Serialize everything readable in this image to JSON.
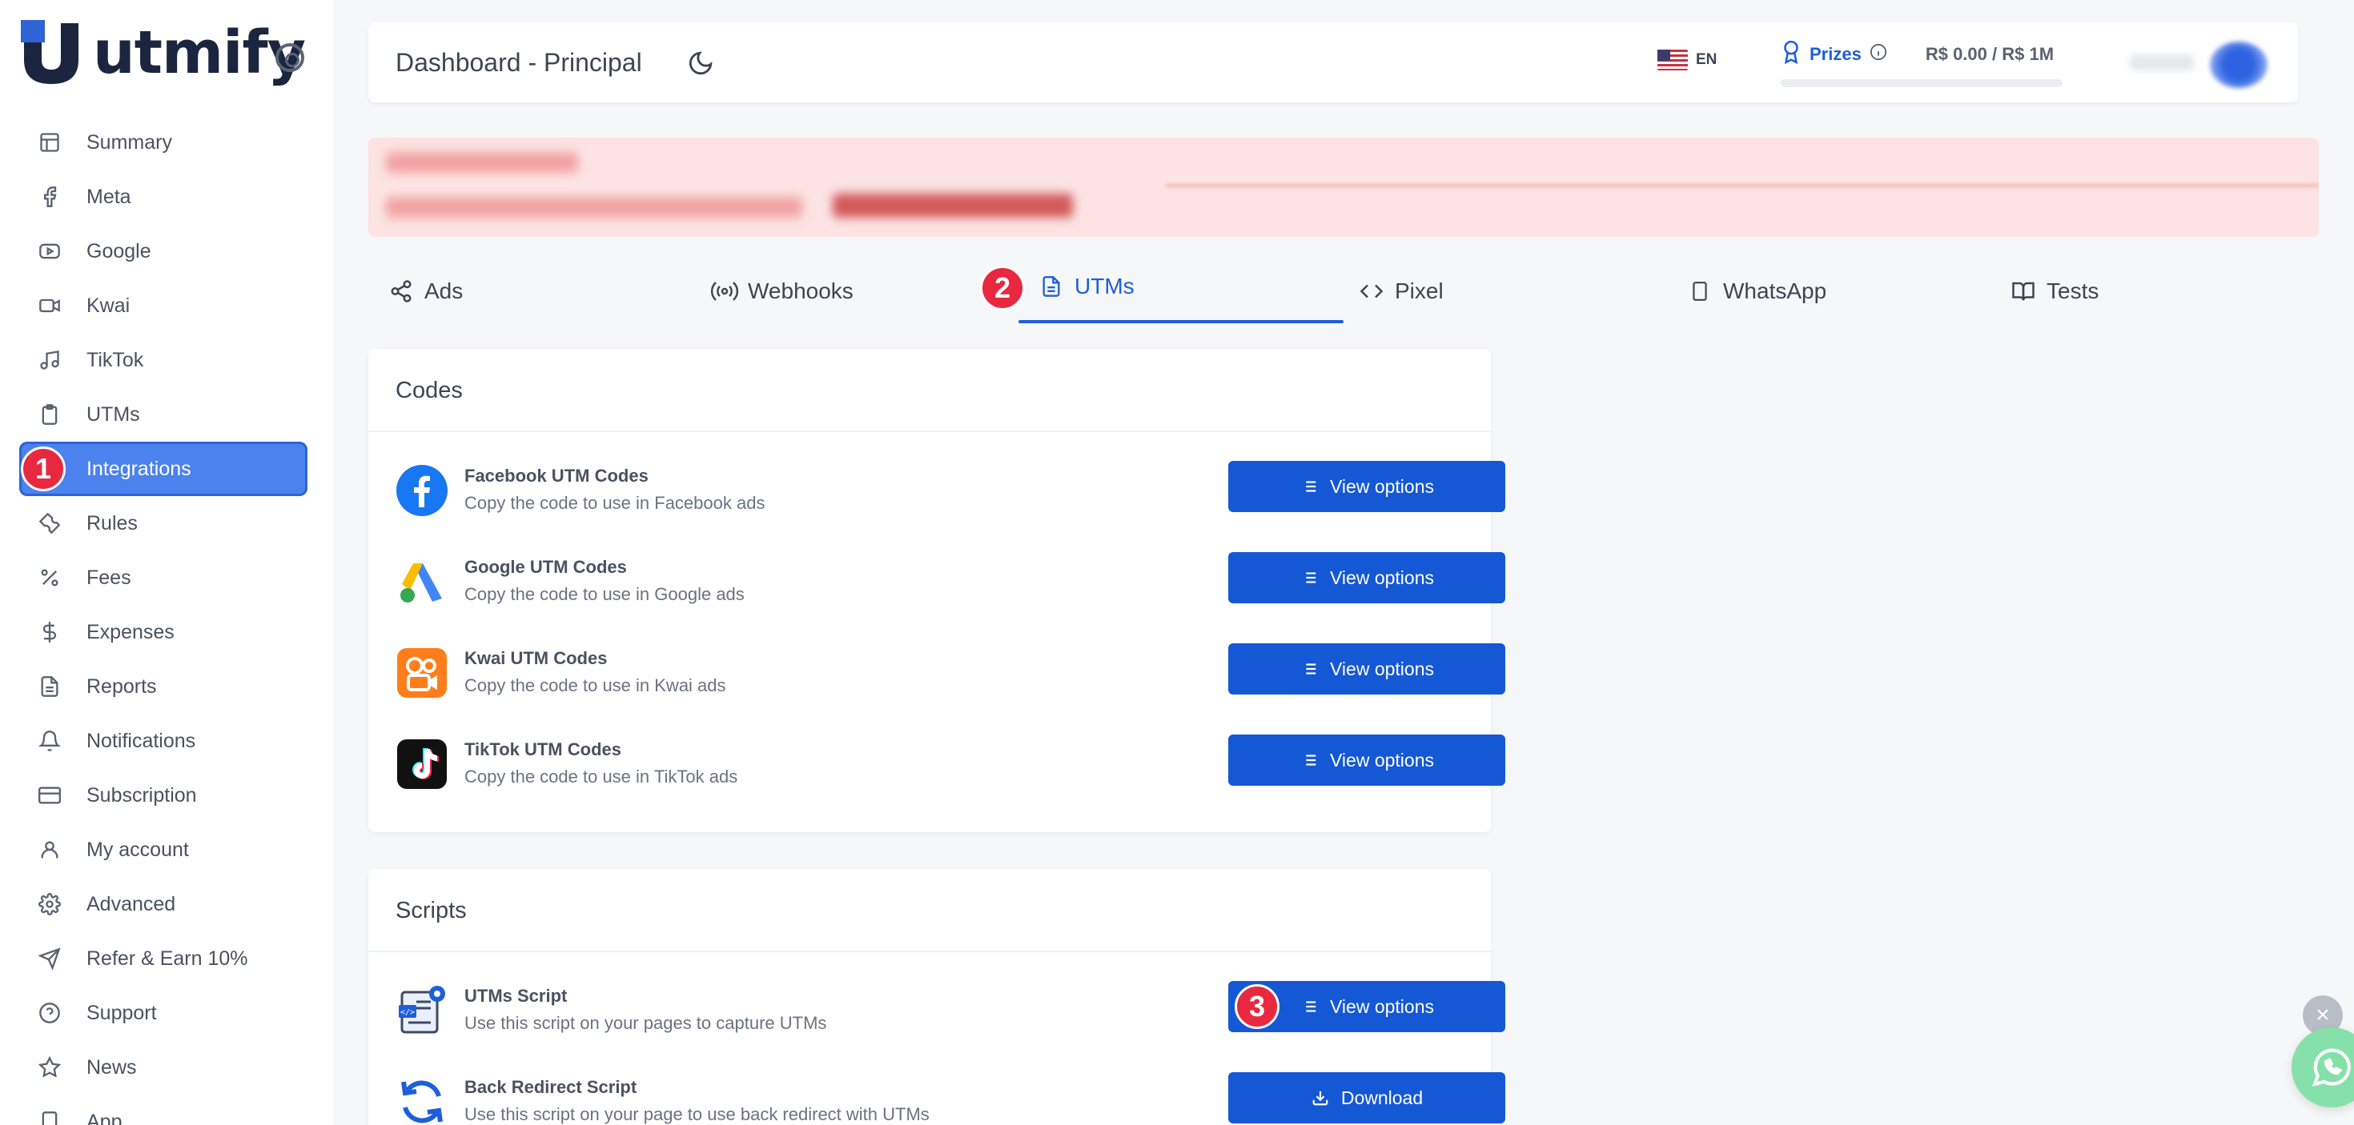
{
  "brand": {
    "name": "utmify"
  },
  "sidebar": {
    "items": [
      {
        "label": "Summary",
        "icon": "layout-icon"
      },
      {
        "label": "Meta",
        "icon": "facebook-icon"
      },
      {
        "label": "Google",
        "icon": "youtube-icon"
      },
      {
        "label": "Kwai",
        "icon": "video-camera-icon"
      },
      {
        "label": "TikTok",
        "icon": "music-note-icon"
      },
      {
        "label": "UTMs",
        "icon": "clipboard-icon"
      },
      {
        "label": "Integrations",
        "icon": "plug-icon",
        "active": true,
        "badge": "1"
      },
      {
        "label": "Rules",
        "icon": "wrench-icon"
      },
      {
        "label": "Fees",
        "icon": "percent-icon"
      },
      {
        "label": "Expenses",
        "icon": "dollar-icon"
      },
      {
        "label": "Reports",
        "icon": "document-icon"
      },
      {
        "label": "Notifications",
        "icon": "bell-icon"
      },
      {
        "label": "Subscription",
        "icon": "credit-card-icon"
      },
      {
        "label": "My account",
        "icon": "user-icon"
      },
      {
        "label": "Advanced",
        "icon": "gear-icon"
      },
      {
        "label": "Refer & Earn 10%",
        "icon": "send-icon"
      },
      {
        "label": "Support",
        "icon": "help-circle-icon"
      },
      {
        "label": "News",
        "icon": "star-icon"
      },
      {
        "label": "App",
        "icon": "smartphone-icon"
      }
    ]
  },
  "header": {
    "title": "Dashboard - Principal",
    "language": "EN",
    "prizes_label": "Prizes",
    "prizes_value": "R$ 0.00  /  R$ 1M"
  },
  "tabs": [
    {
      "label": "Ads",
      "icon": "share-icon"
    },
    {
      "label": "Webhooks",
      "icon": "broadcast-icon"
    },
    {
      "label": "UTMs",
      "icon": "file-text-icon",
      "active": true,
      "badge": "2"
    },
    {
      "label": "Pixel",
      "icon": "code-icon"
    },
    {
      "label": "WhatsApp",
      "icon": "smartphone-icon"
    },
    {
      "label": "Tests",
      "icon": "book-icon"
    }
  ],
  "codes": {
    "title": "Codes",
    "rows": [
      {
        "title": "Facebook UTM Codes",
        "subtitle": "Copy the code to use in Facebook ads",
        "button": "View options"
      },
      {
        "title": "Google UTM Codes",
        "subtitle": "Copy the code to use in Google ads",
        "button": "View options"
      },
      {
        "title": "Kwai UTM Codes",
        "subtitle": "Copy the code to use in Kwai ads",
        "button": "View options"
      },
      {
        "title": "TikTok UTM Codes",
        "subtitle": "Copy the code to use in TikTok ads",
        "button": "View options"
      }
    ]
  },
  "scripts": {
    "title": "Scripts",
    "rows": [
      {
        "title": "UTMs Script",
        "subtitle": "Use this script on your pages to capture UTMs",
        "button": "View options",
        "badge": "3"
      },
      {
        "title": "Back Redirect Script",
        "subtitle": "Use this script on your page to use back redirect with UTMs",
        "button": "Download"
      }
    ]
  },
  "colors": {
    "primary": "#1558d6",
    "active_nav": "#4c82ee",
    "badge": "#e8283f",
    "alert_bg": "#fde3e3"
  }
}
